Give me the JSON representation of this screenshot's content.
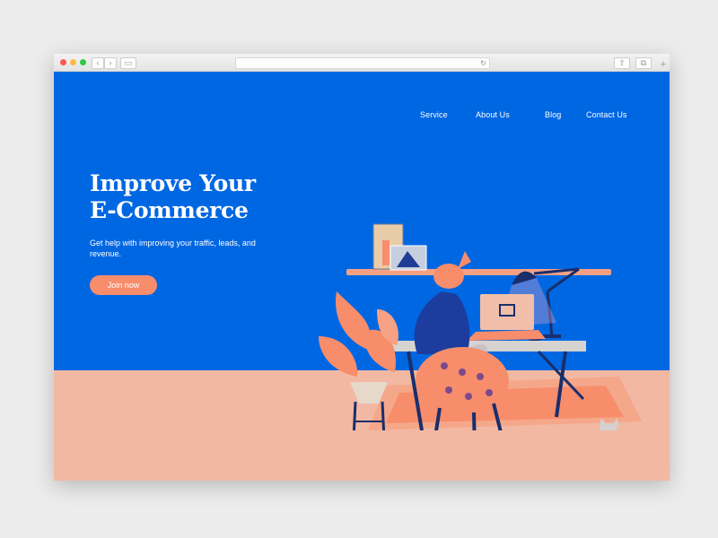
{
  "nav": {
    "service": "Service",
    "about": "About Us",
    "blog": "Blog",
    "contact": "Contact Us"
  },
  "hero": {
    "title_line1": "Improve Your",
    "title_line2": "E-Commerce",
    "subtitle": "Get help with improving your traffic, leads, and revenue.",
    "cta": "Join now"
  },
  "colors": {
    "background_blue": "#0067e3",
    "floor_peach": "#f2b8a2",
    "accent_coral": "#f78d6b"
  },
  "browser": {
    "icons": [
      "back-arrow-icon",
      "forward-arrow-icon",
      "sidebar-icon",
      "reload-icon",
      "share-icon",
      "tabs-icon",
      "plus-icon"
    ]
  }
}
